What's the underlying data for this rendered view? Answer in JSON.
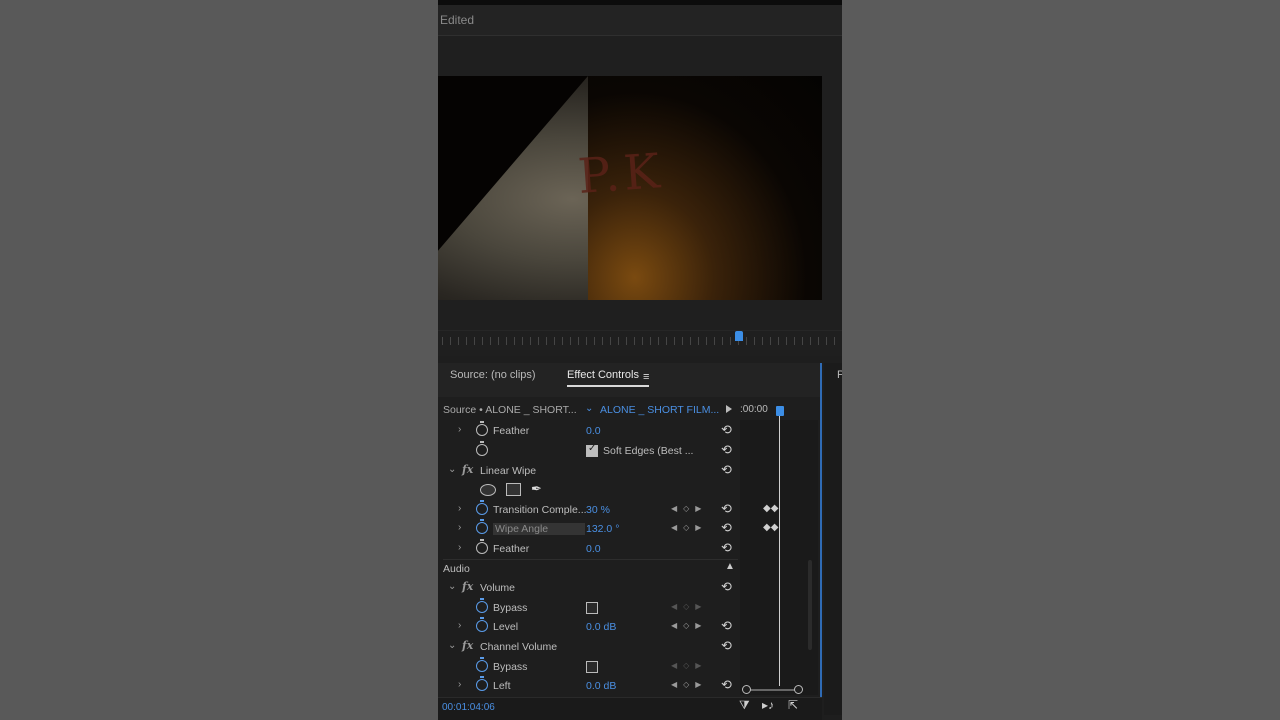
{
  "window": {
    "title": "Edited"
  },
  "video_overlay": {
    "letters": "P.K"
  },
  "tabs": [
    {
      "label": "Source: (no clips)",
      "active": false
    },
    {
      "label": "Effect Controls",
      "active": true
    }
  ],
  "tab_menu_glyph": "≡",
  "effect_controls": {
    "source_label": "Source • ALONE _ SHORT...",
    "clip_label": "ALONE _ SHORT FILM...",
    "timecode_top": ":00:00",
    "timecode_bottom": "00:01:04:06",
    "rows": {
      "feather1": {
        "label": "Feather",
        "value": "0.0"
      },
      "soft_edges": {
        "label": "Soft Edges (Best ...",
        "checked": true
      },
      "linear_wipe": {
        "label": "Linear Wipe"
      },
      "transition_completion": {
        "label": "Transition Comple...",
        "value": "30 %"
      },
      "wipe_angle": {
        "label": "Wipe Angle",
        "value": "132.0 °"
      },
      "feather2": {
        "label": "Feather",
        "value": "0.0"
      },
      "audio": {
        "label": "Audio"
      },
      "volume": {
        "label": "Volume"
      },
      "volume_bypass": {
        "label": "Bypass",
        "checked": false
      },
      "level": {
        "label": "Level",
        "value": "0.0 dB"
      },
      "channel_volume": {
        "label": "Channel Volume"
      },
      "channel_bypass": {
        "label": "Bypass",
        "checked": false
      },
      "left": {
        "label": "Left",
        "value": "0.0 dB"
      }
    }
  },
  "glyphs": {
    "reset": "⟲",
    "chev_right": "›",
    "chev_down": "⌄",
    "fx": "fx",
    "caret_up": "▲",
    "kf_nav": "◀◇▶",
    "keyframe_pair": "◆◆",
    "pen": "✒",
    "filter": "⧩",
    "play_audio": "▸♪",
    "export": "⇱"
  },
  "right_edge_letter": "P",
  "colors": {
    "accent": "#4a8fe2",
    "panel": "#1e1e1e",
    "backdrop": "#5a5a5a"
  }
}
